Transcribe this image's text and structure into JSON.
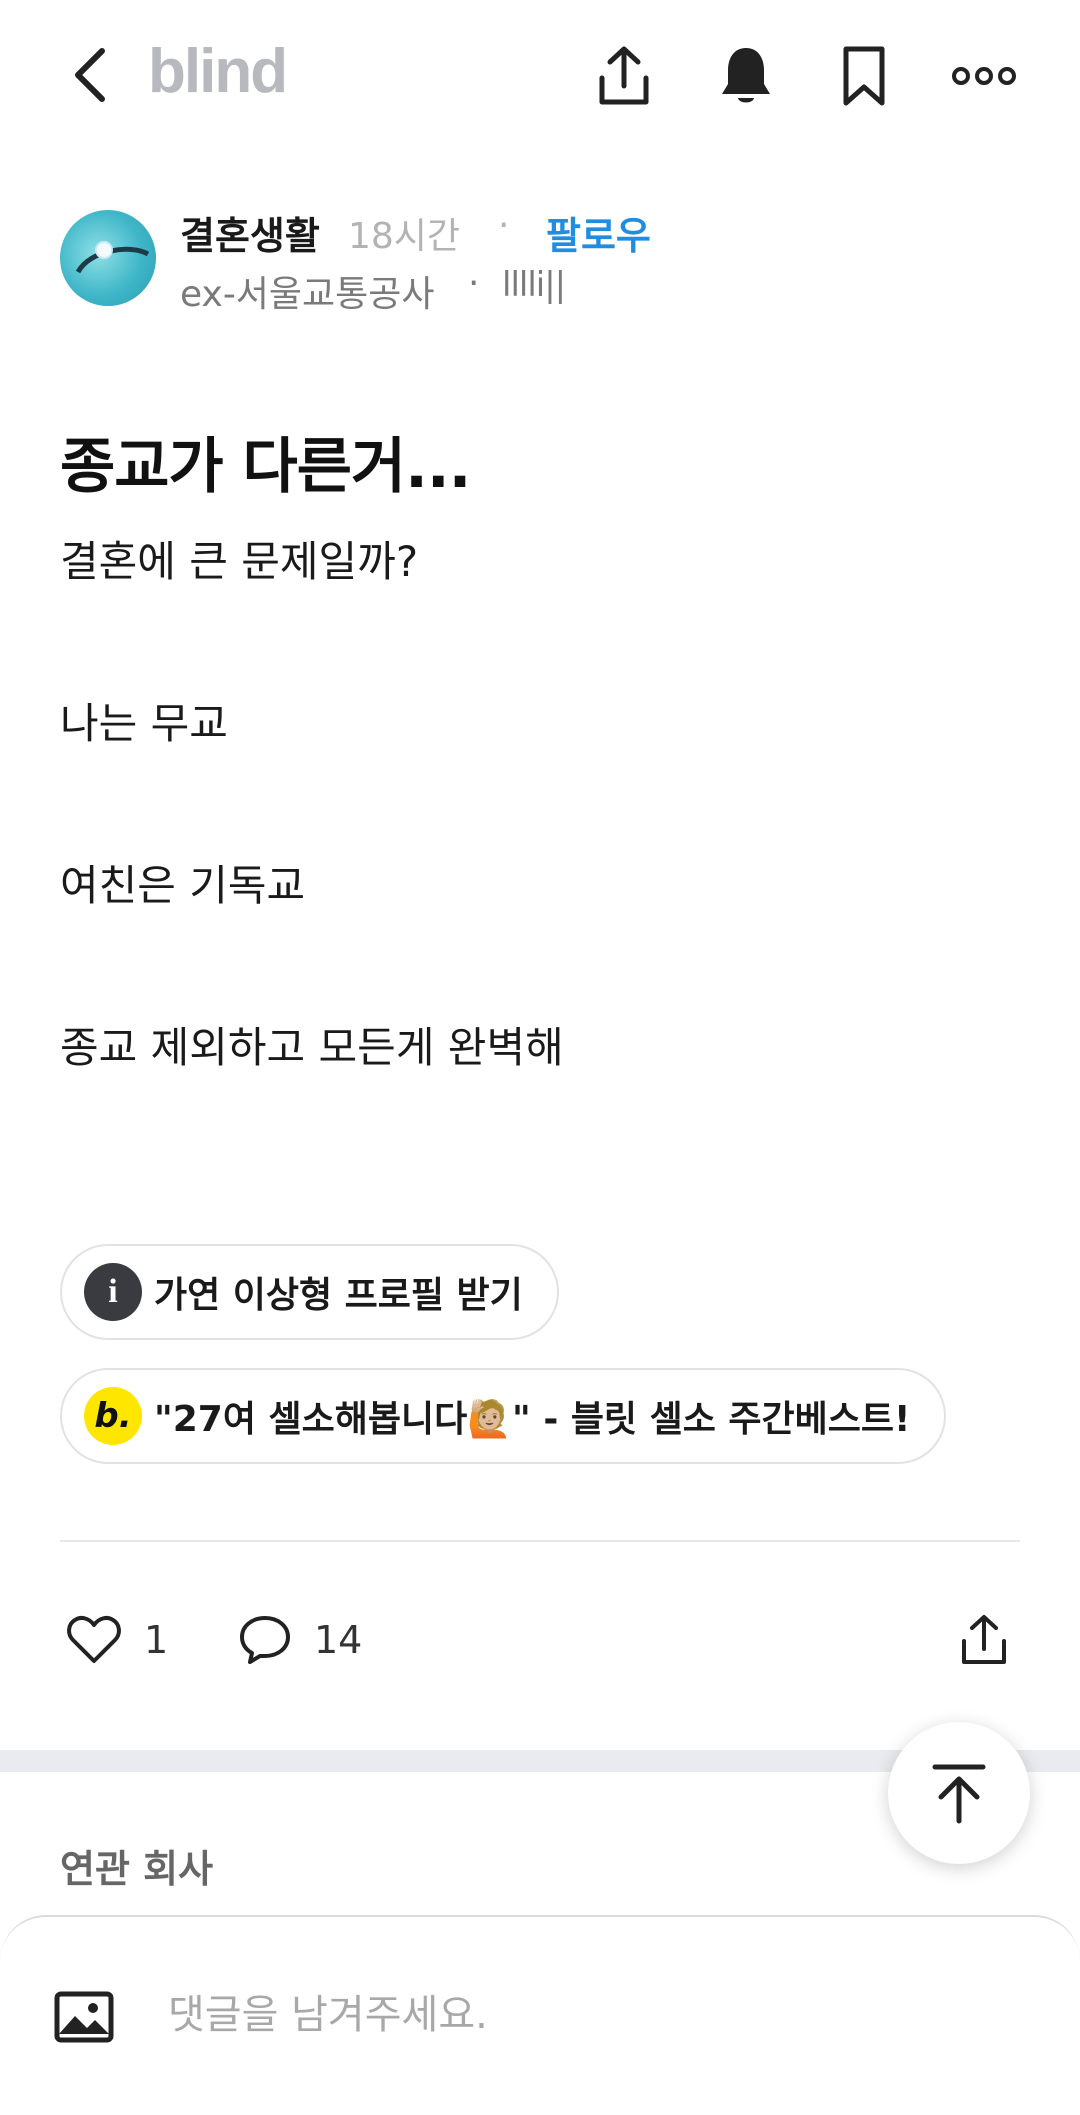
{
  "header": {
    "logo": "blind",
    "icons": [
      "chevron-left-icon",
      "share-icon",
      "bell-icon",
      "bookmark-icon",
      "more-icon"
    ]
  },
  "author": {
    "name": "결혼생활",
    "time": "18시간",
    "separator": "·",
    "follow_label": "팔로우",
    "company": "ex-서울교통공사",
    "badge": "lllli||"
  },
  "post": {
    "title": "종교가 다른거...",
    "lines": [
      "결혼에 큰 문제일까?",
      "나는 무교",
      "여친은 기독교",
      "종교 제외하고 모든게 완벽해"
    ]
  },
  "chips": [
    {
      "icon_letter": "i",
      "label": "가연 이상형 프로필 받기"
    },
    {
      "icon_letter": "b.",
      "label": "\"27여 셀소해봅니다🙋🏼\" - 블릿 셀소 주간베스트!"
    }
  ],
  "actions": {
    "likes": "1",
    "comments": "14"
  },
  "related": {
    "title": "연관 회사"
  },
  "comment_box": {
    "placeholder": "댓글을 남겨주세요."
  },
  "colors": {
    "accent_blue": "#1f8de0",
    "logo_gray": "#b7b9bf",
    "chip_b_yellow": "#ffe600",
    "chip_i_dark": "#3a3b40"
  }
}
